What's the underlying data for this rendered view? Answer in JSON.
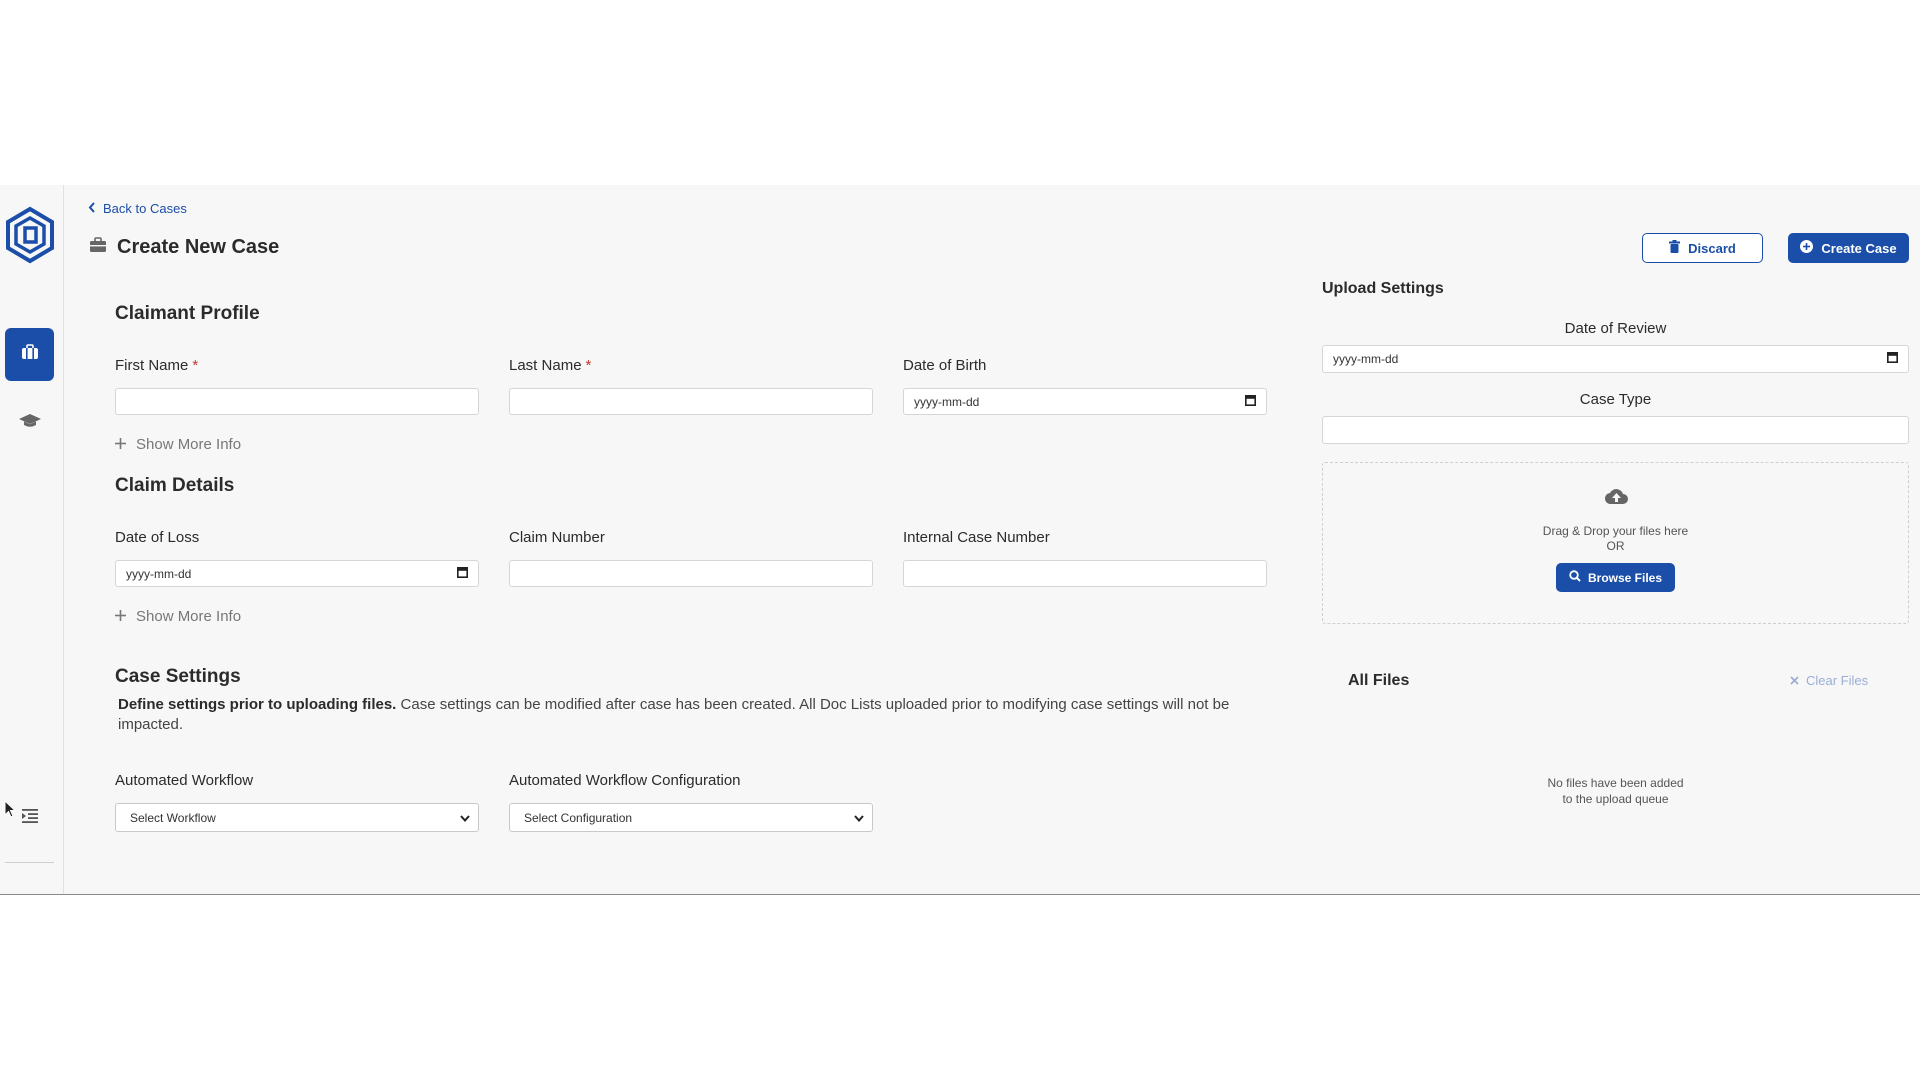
{
  "header": {
    "back_link": "Back to Cases",
    "page_title": "Create New Case",
    "discard_label": "Discard",
    "create_label": "Create Case"
  },
  "claimant_profile": {
    "title": "Claimant Profile",
    "first_name_label": "First Name",
    "last_name_label": "Last Name",
    "dob_label": "Date of Birth",
    "dob_placeholder": "yyyy-mm-dd",
    "required_mark": "*",
    "show_more": "Show More Info"
  },
  "claim_details": {
    "title": "Claim Details",
    "date_of_loss_label": "Date of Loss",
    "date_of_loss_placeholder": "yyyy-mm-dd",
    "claim_number_label": "Claim Number",
    "internal_case_number_label": "Internal Case Number",
    "show_more": "Show More Info"
  },
  "case_settings": {
    "title": "Case Settings",
    "description_bold": "Define settings prior to uploading files.",
    "description_rest": " Case settings can be modified after case has been created. All Doc Lists uploaded prior to modifying case settings will not be impacted.",
    "workflow_label": "Automated Workflow",
    "workflow_selected": "Select Workflow",
    "config_label": "Automated Workflow Configuration",
    "config_selected": "Select Configuration"
  },
  "upload_settings": {
    "title": "Upload Settings",
    "date_of_review_label": "Date of Review",
    "date_of_review_placeholder": "yyyy-mm-dd",
    "case_type_label": "Case Type",
    "drop_text": "Drag & Drop your files here",
    "or_text": "OR",
    "browse_label": "Browse Files",
    "all_files_title": "All Files",
    "clear_files_label": "Clear Files",
    "no_files_line1": "No files have been added",
    "no_files_line2": "to the upload queue"
  },
  "colors": {
    "primary": "#1a4ea8",
    "required": "#c0392b",
    "background": "#f7f7f7"
  },
  "icons": {
    "logo": "app-logo-icon",
    "cases": "briefcase-icon",
    "training": "graduation-cap-icon",
    "menu": "indent-menu-icon",
    "back": "chevron-left-icon",
    "title": "briefcase-icon",
    "discard": "trash-icon",
    "create": "plus-circle-icon",
    "calendar": "calendar-icon",
    "plus": "plus-icon",
    "upload": "cloud-upload-icon",
    "browse": "search-icon",
    "clear": "close-icon",
    "select": "chevron-down-icon"
  }
}
